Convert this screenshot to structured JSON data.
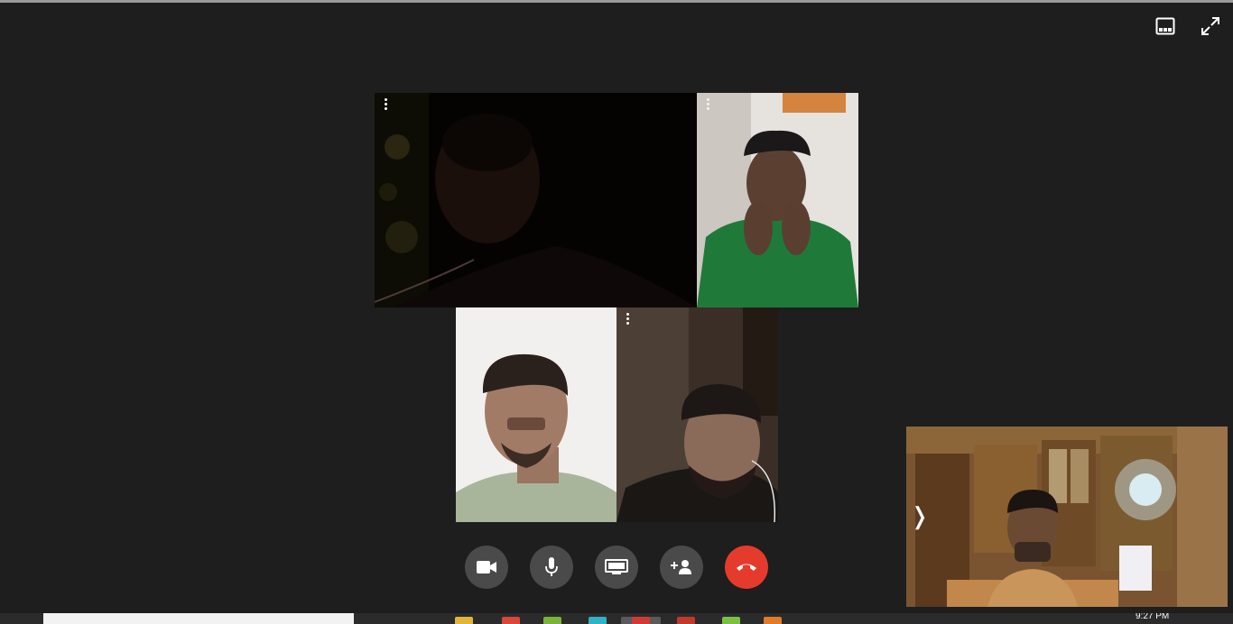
{
  "window": {
    "layout_icon": "layout-icon",
    "fullscreen_icon": "fullscreen-icon"
  },
  "participants": [
    {
      "position": "top-left",
      "lighting": "dark",
      "menu_icon": "more-vert-icon"
    },
    {
      "position": "top-right",
      "lighting": "bright",
      "menu_icon": "more-vert-icon"
    },
    {
      "position": "bottom-left",
      "lighting": "bright"
    },
    {
      "position": "bottom-right",
      "lighting": "dim",
      "menu_icon": "more-vert-icon"
    }
  ],
  "self_view": {
    "expand_glyph": "❭",
    "expand_icon": "chevron-right-icon"
  },
  "controls": [
    {
      "id": "camera",
      "icon": "videocam-icon"
    },
    {
      "id": "microphone",
      "icon": "mic-icon"
    },
    {
      "id": "present",
      "icon": "screen-share-icon"
    },
    {
      "id": "add-people",
      "icon": "person-add-icon"
    },
    {
      "id": "hang-up",
      "icon": "call-end-icon",
      "color": "#e53b2c"
    }
  ],
  "taskbar": {
    "clock": "9:27 PM"
  },
  "colors": {
    "background": "#1e1e1e",
    "control_button": "#4a4a4a",
    "hangup": "#e53b2c"
  }
}
